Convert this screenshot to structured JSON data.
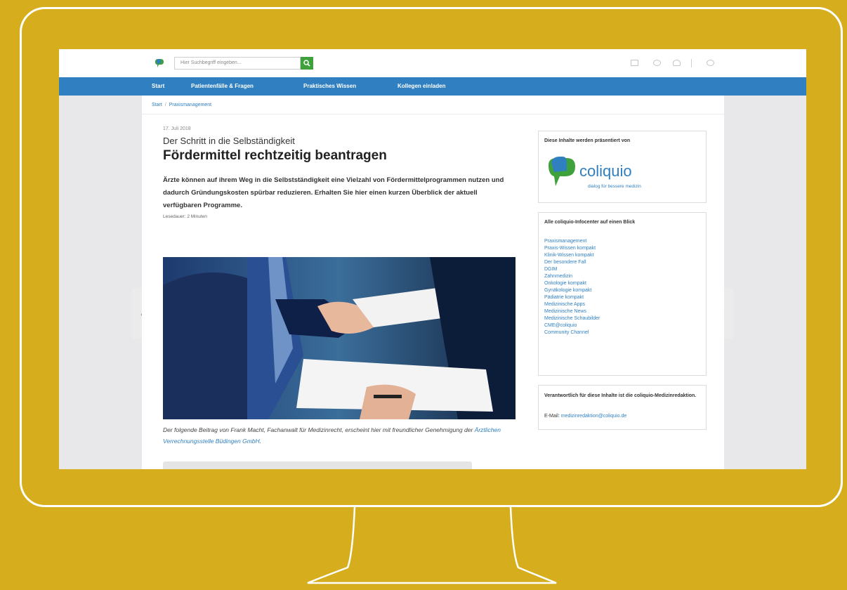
{
  "search": {
    "placeholder": "Hier Suchbegriff eingeben..."
  },
  "nav": {
    "items": [
      "Start",
      "Patientenfälle & Fragen",
      "Praktisches Wissen",
      "Kollegen einladen"
    ]
  },
  "breadcrumb": {
    "home": "Start",
    "current": "Praxismanagement"
  },
  "article": {
    "date": "17. Juli 2018",
    "kicker": "Der Schritt in die Selbständigkeit",
    "headline": "Fördermittel rechtzeitig beantragen",
    "lead": "Ärzte können auf ihrem Weg in die Selbstständigkeit eine Vielzahl von Fördermittelprogrammen nutzen und dadurch Gründungskosten spürbar reduzieren. Erhalten Sie hier einen kurzen Überblick der aktuell verfügbaren Programme.",
    "read_time": "Lesedauer: 2 Minuten",
    "caption_prefix": "Der folgende Beitrag von Frank Macht, Fachanwalt für Medizinrecht, erscheint hier mit freundlicher Genehmigung der",
    "caption_link": "Ärztlichen Verrechnungsstelle Büdingen GmbH",
    "caption_suffix": "."
  },
  "sponsor": {
    "title": "Diese Inhalte werden präsentiert von",
    "brand": "coliquio",
    "tagline": "dialog für bessere medizin"
  },
  "infocenter": {
    "title": "Alle coliquio-Infocenter auf einen Blick",
    "links": [
      "Praxismanagement",
      "Praxis-Wissen kompakt",
      "Klinik-Wissen kompakt",
      "Der besondere Fall",
      "DGIM",
      "Zahnmedizin",
      "Onkologie kompakt",
      "Gynäkologie kompakt",
      "Pädiatrie kompakt",
      "Medizinische Apps",
      "Medizinische News",
      "Medizinische Schaubilder",
      "CME@coliquio",
      "Community Channel"
    ]
  },
  "responsible": {
    "text": "Verantwortlich für diese Inhalte ist die coliquio-Medizinredaktion.",
    "email_label": "E-Mail:",
    "email": "medizinredaktion@coliquio.de"
  },
  "colors": {
    "nav_blue": "#2f7fc1",
    "search_green": "#3ea13b",
    "background": "#d6ae1d"
  }
}
